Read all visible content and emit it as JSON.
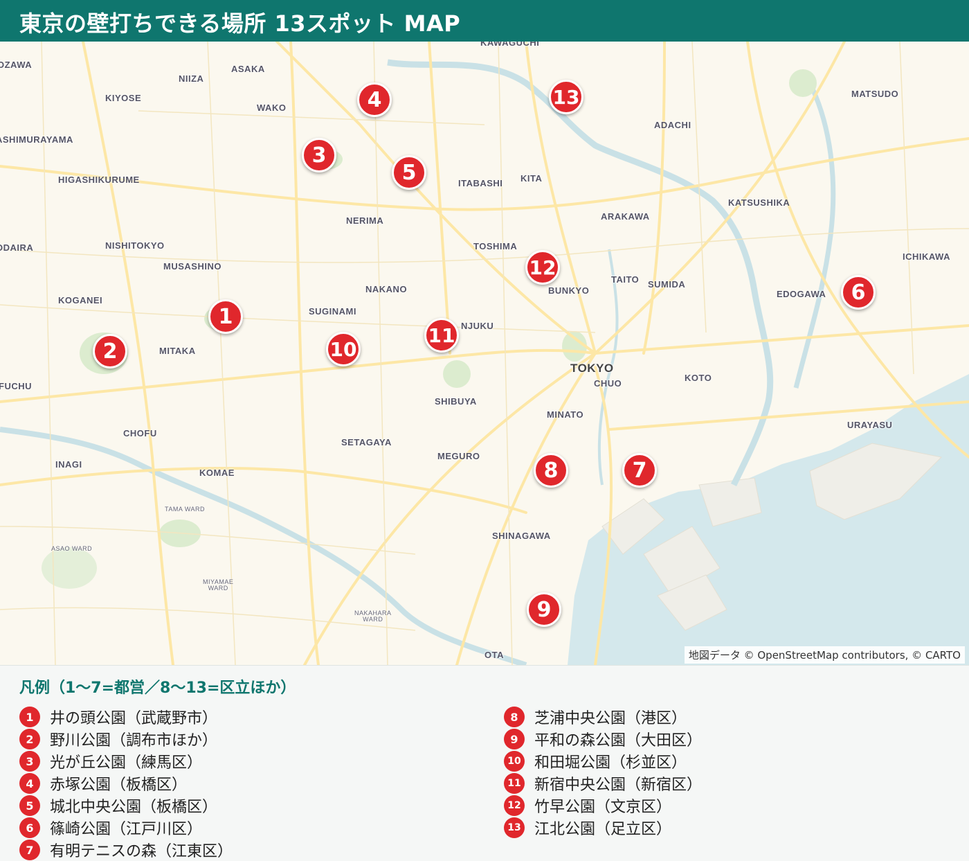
{
  "header": {
    "title": "東京の壁打ちできる場所 13スポット MAP"
  },
  "map": {
    "attribution": "地図データ © OpenStreetMap contributors, © CARTO",
    "places": [
      {
        "name": "OZAWA",
        "style": "normal"
      },
      {
        "name": "NIIZA",
        "style": "normal"
      },
      {
        "name": "ASAKA",
        "style": "normal"
      },
      {
        "name": "KAWAGUCHI",
        "style": "normal"
      },
      {
        "name": "KIYOSE",
        "style": "normal"
      },
      {
        "name": "WAKO",
        "style": "normal"
      },
      {
        "name": "MATSUDO",
        "style": "normal"
      },
      {
        "name": "ADACHI",
        "style": "normal"
      },
      {
        "name": "ASHIMURAYAMA",
        "style": "normal"
      },
      {
        "name": "HIGASHIKURUME",
        "style": "normal"
      },
      {
        "name": "ITABASHI",
        "style": "normal"
      },
      {
        "name": "KITA",
        "style": "normal"
      },
      {
        "name": "KATSUSHIKA",
        "style": "normal"
      },
      {
        "name": "NERIMA",
        "style": "normal"
      },
      {
        "name": "ARAKAWA",
        "style": "normal"
      },
      {
        "name": "ODAIRA",
        "style": "normal"
      },
      {
        "name": "NISHITOKYO",
        "style": "normal"
      },
      {
        "name": "TOSHIMA",
        "style": "normal"
      },
      {
        "name": "ICHIKAWA",
        "style": "normal"
      },
      {
        "name": "MUSASHINO",
        "style": "normal"
      },
      {
        "name": "TAITO",
        "style": "normal"
      },
      {
        "name": "SUMIDA",
        "style": "normal"
      },
      {
        "name": "NAKANO",
        "style": "normal"
      },
      {
        "name": "BUNKYO",
        "style": "normal"
      },
      {
        "name": "EDOGAWA",
        "style": "normal"
      },
      {
        "name": "KOGANEI",
        "style": "normal"
      },
      {
        "name": "SUGINAMI",
        "style": "normal"
      },
      {
        "name": "NJUKU",
        "style": "normal"
      },
      {
        "name": "MITAKA",
        "style": "normal"
      },
      {
        "name": "TOKYO",
        "style": "big"
      },
      {
        "name": "CHUO",
        "style": "normal"
      },
      {
        "name": "KOTO",
        "style": "normal"
      },
      {
        "name": "FUCHU",
        "style": "normal"
      },
      {
        "name": "SHIBUYA",
        "style": "normal"
      },
      {
        "name": "MINATO",
        "style": "normal"
      },
      {
        "name": "URAYASU",
        "style": "normal"
      },
      {
        "name": "CHOFU",
        "style": "normal"
      },
      {
        "name": "SETAGAYA",
        "style": "normal"
      },
      {
        "name": "MEGURO",
        "style": "normal"
      },
      {
        "name": "INAGI",
        "style": "normal"
      },
      {
        "name": "KOMAE",
        "style": "normal"
      },
      {
        "name": "TAMA WARD",
        "style": "small"
      },
      {
        "name": "SHINAGAWA",
        "style": "normal"
      },
      {
        "name": "ASAO WARD",
        "style": "small"
      },
      {
        "name": "MIYAMAE WARD",
        "style": "small"
      },
      {
        "name": "NAKAHARA WARD",
        "style": "small"
      },
      {
        "name": "OTA",
        "style": "normal"
      }
    ],
    "markers": [
      "1",
      "2",
      "3",
      "4",
      "5",
      "6",
      "7",
      "8",
      "9",
      "10",
      "11",
      "12",
      "13"
    ]
  },
  "legend": {
    "title": "凡例（1〜7=都営／8〜13=区立ほか）",
    "left": [
      {
        "num": "1",
        "label": "井の頭公園（武蔵野市）"
      },
      {
        "num": "2",
        "label": "野川公園（調布市ほか）"
      },
      {
        "num": "3",
        "label": "光が丘公園（練馬区）"
      },
      {
        "num": "4",
        "label": "赤塚公園（板橋区）"
      },
      {
        "num": "5",
        "label": "城北中央公園（板橋区）"
      },
      {
        "num": "6",
        "label": "篠崎公園（江戸川区）"
      },
      {
        "num": "7",
        "label": "有明テニスの森（江東区）"
      }
    ],
    "right": [
      {
        "num": "8",
        "label": "芝浦中央公園（港区）"
      },
      {
        "num": "9",
        "label": "平和の森公園（大田区）"
      },
      {
        "num": "10",
        "label": "和田堀公園（杉並区）"
      },
      {
        "num": "11",
        "label": "新宿中央公園（新宿区）"
      },
      {
        "num": "12",
        "label": "竹早公園（文京区）"
      },
      {
        "num": "13",
        "label": "江北公園（足立区）"
      }
    ]
  }
}
